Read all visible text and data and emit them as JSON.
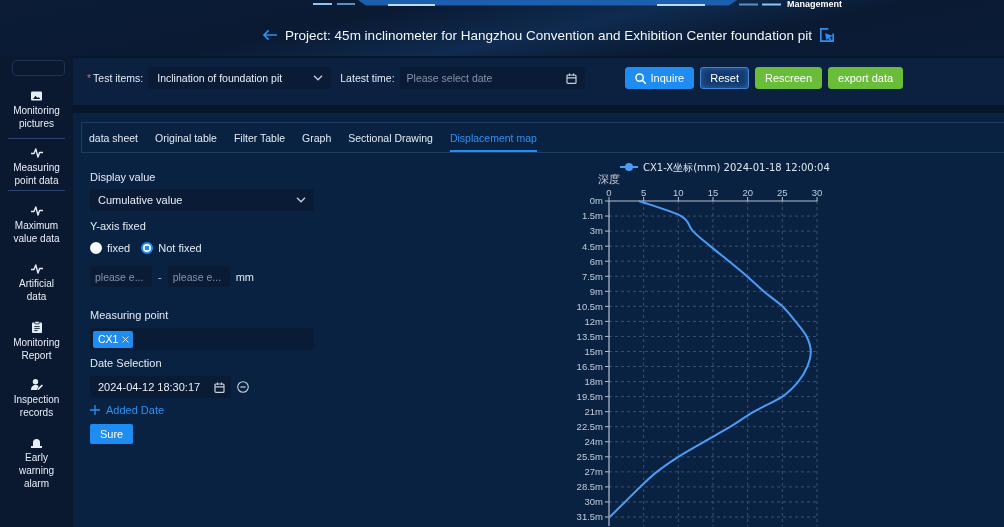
{
  "header": {
    "nav_label": "Management",
    "title": "Project: 45m inclinometer for Hangzhou Convention and Exhibition Center foundation pit"
  },
  "sidebar": {
    "items": [
      {
        "label": "Monitoring pictures",
        "selected": false
      },
      {
        "label": "Measuring point data",
        "selected": true
      },
      {
        "label": "Maximum value data",
        "selected": false
      },
      {
        "label": "Artificial data",
        "selected": false
      },
      {
        "label": "Monitoring Report",
        "selected": false
      },
      {
        "label": "Inspection records",
        "selected": false
      },
      {
        "label": "Early warning alarm",
        "selected": false
      }
    ]
  },
  "filters": {
    "test_items": {
      "required_mark": "*",
      "label": "Test items:",
      "value": "Inclination of foundation pit"
    },
    "latest_time": {
      "label": "Latest time:",
      "placeholder": "Please select date"
    },
    "buttons": [
      {
        "label": "Inquire",
        "kind": "search"
      },
      {
        "label": "Reset",
        "kind": "outline"
      },
      {
        "label": "Rescreen",
        "kind": "success"
      },
      {
        "label": "export data",
        "kind": "success"
      }
    ]
  },
  "tabs": [
    {
      "label": "data sheet",
      "selected": false
    },
    {
      "label": "Original table",
      "selected": false
    },
    {
      "label": "Filter Table",
      "selected": false
    },
    {
      "label": "Graph",
      "selected": false
    },
    {
      "label": "Sectional Drawing",
      "selected": false
    },
    {
      "label": "Displacement map",
      "selected": true
    }
  ],
  "form": {
    "display_value": {
      "label": "Display value",
      "value": "Cumulative value"
    },
    "y_axis": {
      "label": "Y-axis fixed",
      "options": [
        {
          "label": "fixed",
          "selected": false
        },
        {
          "label": "Not fixed",
          "selected": true
        }
      ],
      "range": {
        "min_placeholder": "please e...",
        "separator": "-",
        "max_placeholder": "please e...",
        "unit": "mm"
      }
    },
    "measuring_point": {
      "label": "Measuring point",
      "tags": [
        "CX1"
      ]
    },
    "date_selection": {
      "label": "Date Selection",
      "dates": [
        "2024-04-12 18:30:17"
      ],
      "add_label": "Added Date"
    },
    "submit": "Sure"
  },
  "displacement_map": {
    "chart_data": {
      "type": "line",
      "orientation": "horizontal",
      "grid": true,
      "ylabel": "深度",
      "categories": [
        "0m",
        "1.5m",
        "3m",
        "4.5m",
        "6m",
        "7.5m",
        "9m",
        "10.5m",
        "12m",
        "13.5m",
        "15m",
        "16.5m",
        "18m",
        "19.5m",
        "21m",
        "22.5m",
        "24m",
        "25.5m",
        "27m",
        "28.5m",
        "30m",
        "31.5m"
      ],
      "xlim": [
        0,
        30
      ],
      "xticks": [
        0,
        5,
        10,
        15,
        20,
        25,
        30
      ],
      "series": [
        {
          "name": "CX1-X坐标(mm) 2024-01-18 12:00:04",
          "color": "#4a9cf6",
          "values": [
            4.3,
            10.4,
            12.1,
            14.6,
            17.3,
            19.9,
            22.3,
            25.0,
            26.9,
            28.5,
            29.1,
            28.6,
            27.3,
            25.0,
            20.9,
            17.5,
            13.7,
            10.0,
            6.9,
            4.5,
            2.3,
            0.1
          ]
        }
      ]
    }
  }
}
